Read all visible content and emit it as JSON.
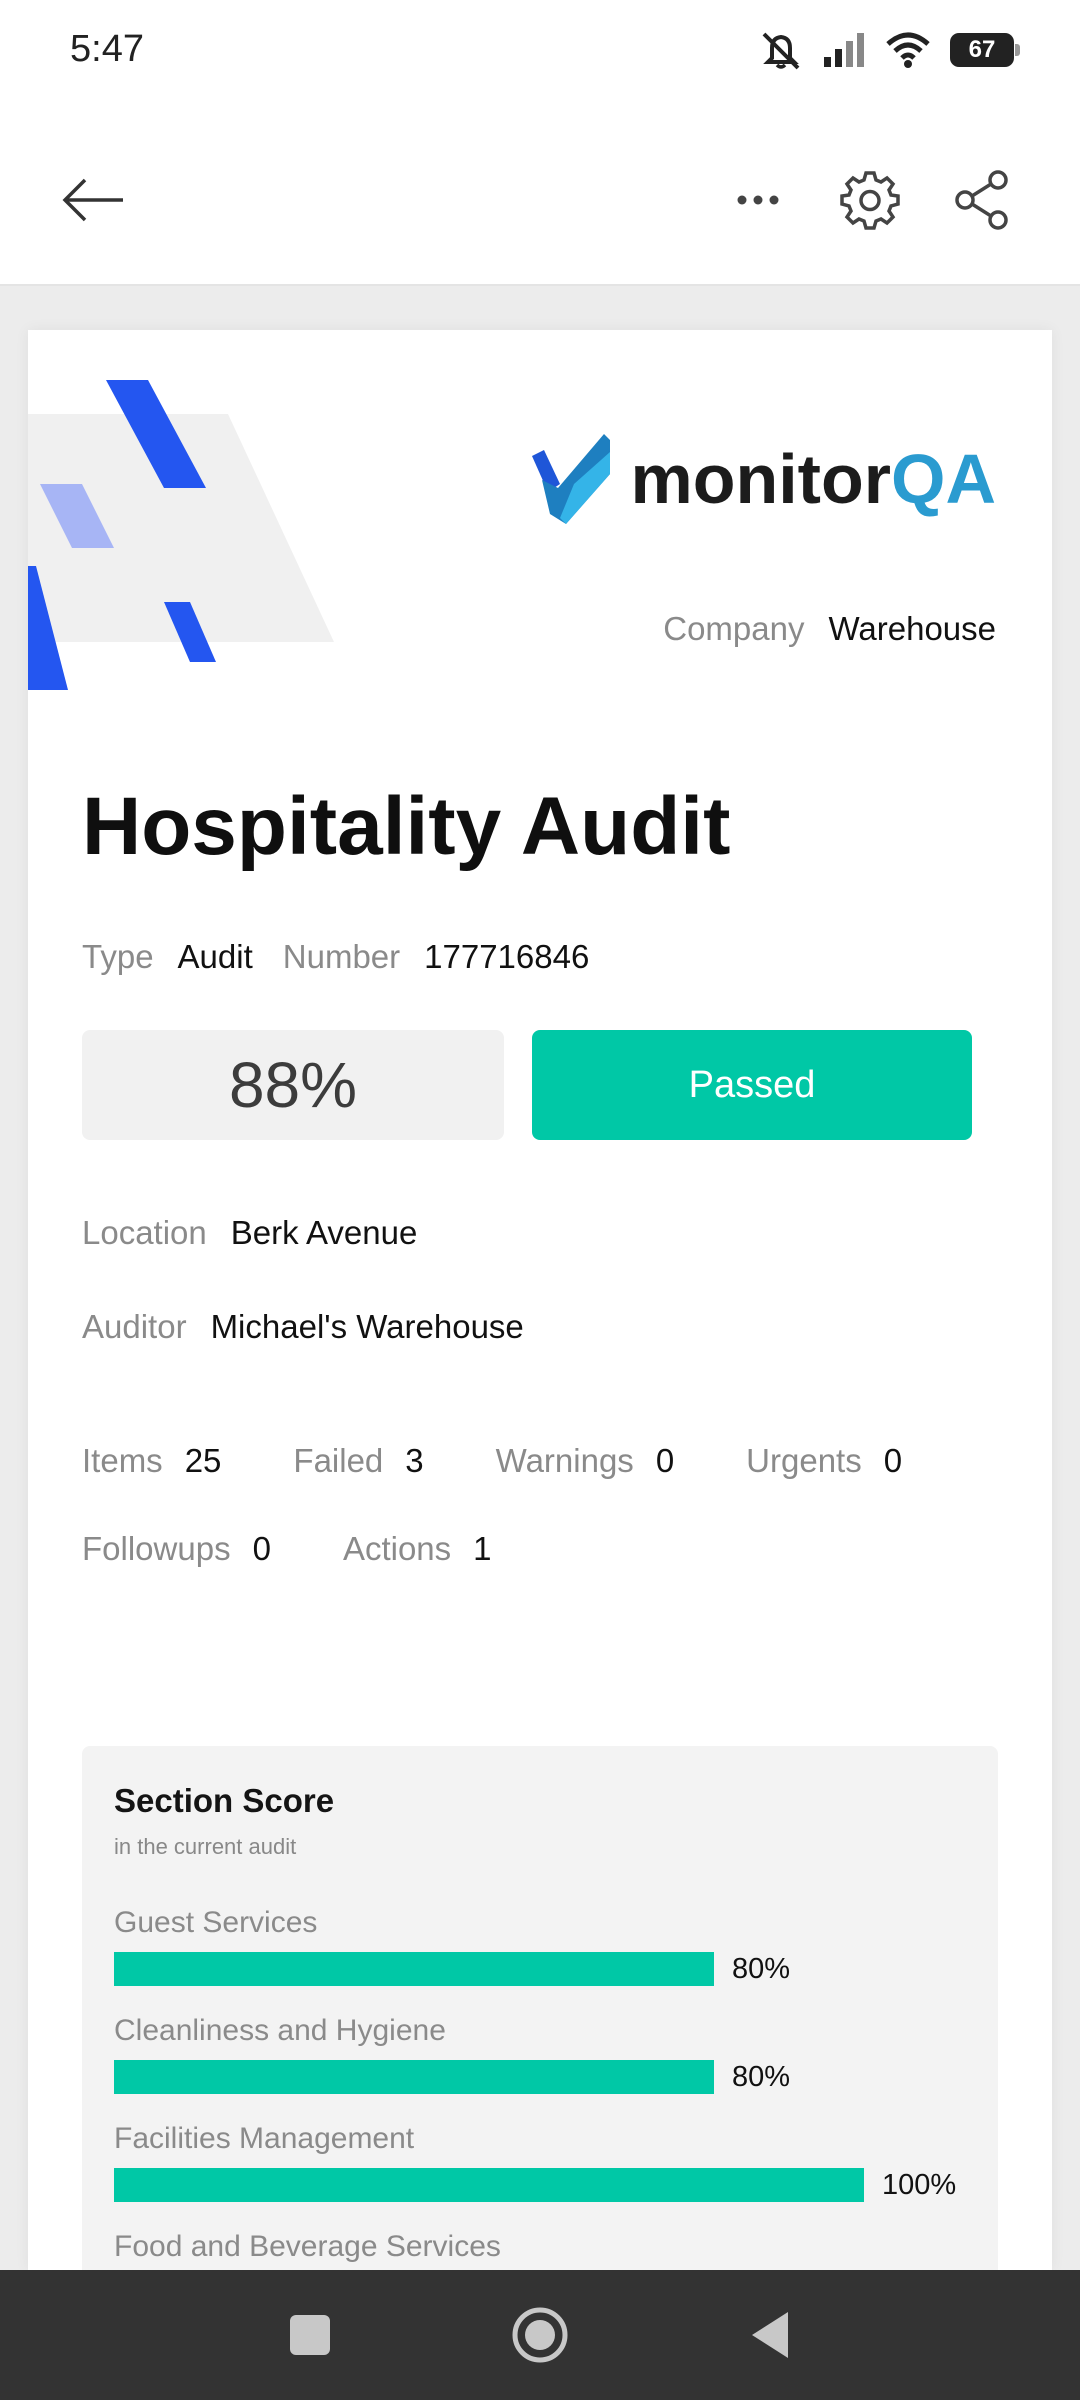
{
  "status_bar": {
    "time": "5:47",
    "battery": "67"
  },
  "report": {
    "company_label": "Company",
    "company_value": "Warehouse",
    "logo_main": "monitor",
    "logo_accent": "QA",
    "title": "Hospitality Audit",
    "type_label": "Type",
    "type_value": "Audit",
    "number_label": "Number",
    "number_value": "177716846",
    "score": "88%",
    "result": "Passed",
    "location_label": "Location",
    "location_value": "Berk Avenue",
    "auditor_label": "Auditor",
    "auditor_value": "Michael's Warehouse",
    "stats": {
      "items_label": "Items",
      "items_value": "25",
      "failed_label": "Failed",
      "failed_value": "3",
      "warnings_label": "Warnings",
      "warnings_value": "0",
      "urgents_label": "Urgents",
      "urgents_value": "0",
      "followups_label": "Followups",
      "followups_value": "0",
      "actions_label": "Actions",
      "actions_value": "1"
    }
  },
  "section_score": {
    "title": "Section Score",
    "subtitle": "in the current audit",
    "items": [
      {
        "label": "Guest Services",
        "percent": 80,
        "percent_text": "80%"
      },
      {
        "label": "Cleanliness and Hygiene",
        "percent": 80,
        "percent_text": "80%"
      },
      {
        "label": "Facilities Management",
        "percent": 100,
        "percent_text": "100%"
      },
      {
        "label": "Food and Beverage Services"
      }
    ]
  },
  "colors": {
    "accent": "#00c8a6",
    "brand_blue": "#2a9bd0",
    "deco_blue": "#2456f0"
  },
  "icons": [
    "back-arrow-icon",
    "more-icon",
    "gear-icon",
    "share-icon",
    "mute-icon",
    "signal-icon",
    "wifi-icon",
    "recents-icon",
    "home-icon",
    "back-icon"
  ]
}
